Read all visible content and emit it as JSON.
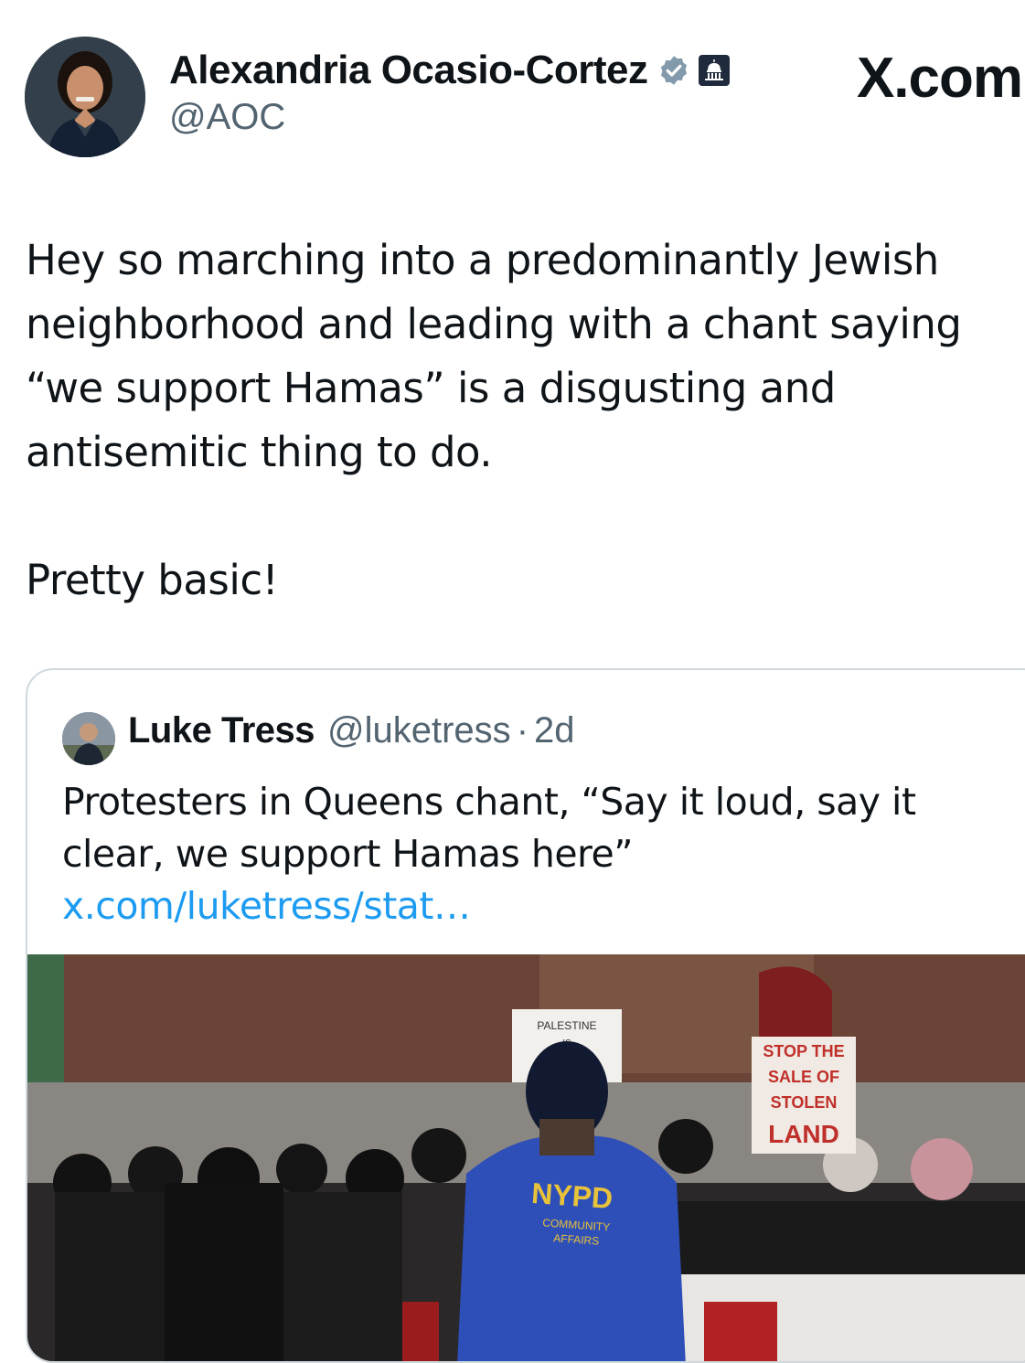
{
  "author": {
    "name": "Alexandria Ocasio-Cortez",
    "handle": "@AOC",
    "verified_icon": "verified-badge-icon",
    "affiliation_icon": "government-capitol-badge-icon"
  },
  "watermark": "X.com",
  "tweet": {
    "text": "Hey so marching into a predominantly Jewish neighborhood and leading with a chant saying “we support Hamas” is a disgusting and antisemitic thing to do.\n\nPretty basic!"
  },
  "quoted": {
    "name": "Luke Tress",
    "handle": "@luketress",
    "separator": "·",
    "time": "2d",
    "text": "Protesters in Queens chant, “Say it loud, say it clear, we support Hamas here” ",
    "link": "x.com/luketress/stat…",
    "media": {
      "sign_left": "PALESTINE IS",
      "sign_right": "STOP THE SALE OF STOLEN LAND",
      "jacket": "NYPD",
      "jacket_sub": "COMMUNITY AFFAIRS"
    }
  },
  "colors": {
    "text": "#0f1419",
    "secondary": "#536471",
    "link": "#1d9bf0",
    "border": "#cfd9de",
    "verified": "#829aab"
  }
}
